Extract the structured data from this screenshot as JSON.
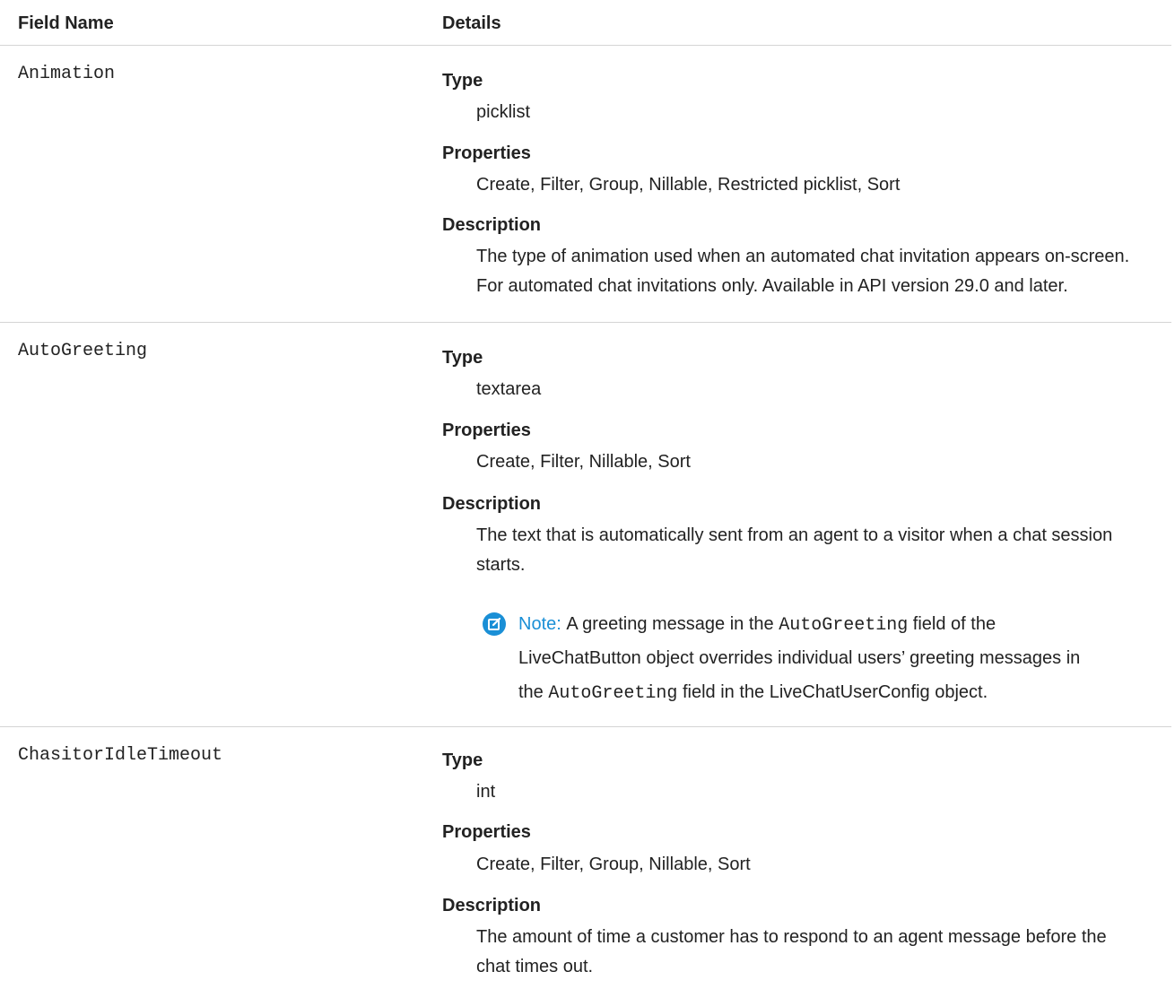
{
  "header": {
    "field_name": "Field Name",
    "details": "Details"
  },
  "labels": {
    "type": "Type",
    "properties": "Properties",
    "description": "Description"
  },
  "rows": [
    {
      "name": "Animation",
      "type": "picklist",
      "properties": "Create, Filter, Group, Nillable, Restricted picklist, Sort",
      "description_lines": [
        "The type of animation used when an automated chat invitation appears on-screen.",
        "For automated chat invitations only. Available in API version 29.0 and later."
      ]
    },
    {
      "name": "AutoGreeting",
      "type": "textarea",
      "properties": "Create, Filter, Nillable, Sort",
      "description_lines": [
        "The text that is automatically sent from an agent to a visitor when a chat session",
        "starts."
      ],
      "note": {
        "icon": "note-edit-icon",
        "label": "Note:",
        "line1_a": "A greeting message in the",
        "line1_code": "AutoGreeting",
        "line1_b": "field of the",
        "line2": "LiveChatButton object overrides individual users’ greeting messages in",
        "line3_a": "the",
        "line3_code": "AutoGreeting",
        "line3_b": "field in the LiveChatUserConfig object."
      }
    },
    {
      "name": "ChasitorIdleTimeout",
      "type": "int",
      "properties": "Create, Filter, Group, Nillable, Sort",
      "description_lines": [
        "The amount of time a customer has to respond to an agent message before the",
        "chat times out."
      ]
    }
  ],
  "colors": {
    "accent": "#1a8fd6",
    "divider": "#d4d4d4",
    "text": "#222222"
  }
}
